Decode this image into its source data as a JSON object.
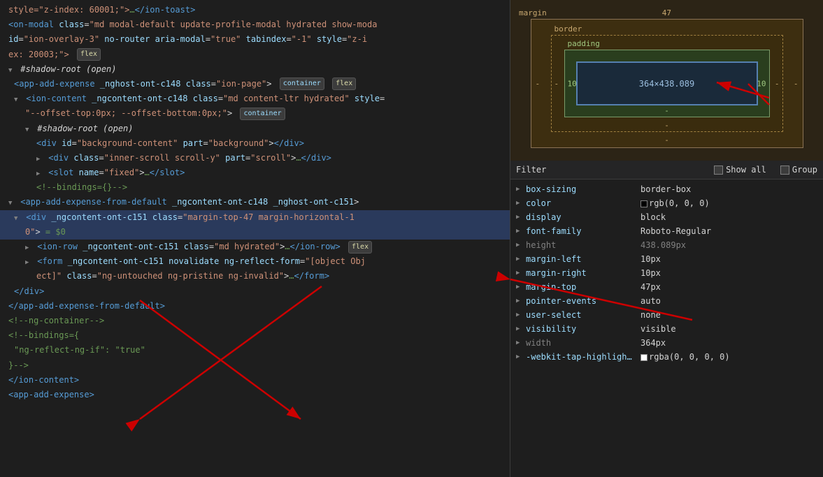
{
  "dom": {
    "lines": [
      {
        "id": 1,
        "indent": 0,
        "html": "<span class='text-orange'>style=\"z-index: 60001;\"></span><span class='comment'>…</span><span class='tag'>&lt;/ion-toast&gt;</span>",
        "highlighted": false
      },
      {
        "id": 2,
        "indent": 0,
        "html": "<span class='tag'>&lt;on-modal</span> <span class='attr-name'>class</span>=<span class='attr-value'>\"md modal-default update-profile-modal hydrated show-moda</span>",
        "highlighted": false
      },
      {
        "id": 3,
        "indent": 0,
        "html": "<span class='attr-name'>id</span>=<span class='attr-value'>\"ion-overlay-3\"</span> <span class='attr-name'>no-router</span> <span class='attr-name'>aria-modal</span>=<span class='attr-value'>\"true\"</span> <span class='attr-name'>tabindex</span>=<span class='attr-value'>\"-1\"</span> <span class='attr-name'>style</span>=<span class='attr-value'>\"z-i</span>",
        "highlighted": false
      },
      {
        "id": 4,
        "indent": 0,
        "html": "<span class='text-orange'>ex: 20003;\"></span> <span class='badge flex'>flex</span>",
        "highlighted": false
      },
      {
        "id": 5,
        "indent": 0,
        "html": "<span class='arrow open'></span> <span class='shadow'>#shadow-root (open)</span>",
        "highlighted": false
      },
      {
        "id": 6,
        "indent": 1,
        "html": "<span class='tag'>&lt;app-add-expense</span> <span class='attr-name'>_nghost-ont-c148</span> <span class='attr-name'>class</span>=<span class='attr-value'>\"ion-page\"</span>&gt; <span class='badge'>container</span> <span class='badge flex'>flex</span>",
        "highlighted": false
      },
      {
        "id": 7,
        "indent": 1,
        "html": "<span class='arrow open'></span> <span class='tag'>&lt;ion-content</span> <span class='attr-name'>_ngcontent-ont-c148</span> <span class='attr-name'>class</span>=<span class='attr-value'>\"md content-ltr hydrated\"</span> <span class='attr-name'>style</span>=",
        "highlighted": false
      },
      {
        "id": 8,
        "indent": 2,
        "html": "<span class='attr-value'>\"--offset-top:0px; --offset-bottom:0px;\"</span>&gt; <span class='badge'>container</span>",
        "highlighted": false
      },
      {
        "id": 9,
        "indent": 2,
        "html": "<span class='arrow open'></span> <span class='shadow'>#shadow-root (open)</span>",
        "highlighted": false
      },
      {
        "id": 10,
        "indent": 3,
        "html": "<span class='tag'>&lt;div</span> <span class='attr-name'>id</span>=<span class='attr-value'>\"background-content\"</span> <span class='attr-name'>part</span>=<span class='attr-value'>\"background\"</span>&gt;<span class='tag'>&lt;/div&gt;</span>",
        "highlighted": false
      },
      {
        "id": 11,
        "indent": 3,
        "html": "<span class='arrow closed'></span> <span class='tag'>&lt;div</span> <span class='attr-name'>class</span>=<span class='attr-value'>\"inner-scroll scroll-y\"</span> <span class='attr-name'>part</span>=<span class='attr-value'>\"scroll\"</span>&gt;<span class='comment'>…</span><span class='tag'>&lt;/div&gt;</span>",
        "highlighted": false
      },
      {
        "id": 12,
        "indent": 3,
        "html": "<span class='arrow closed'></span> <span class='tag'>&lt;slot</span> <span class='attr-name'>name</span>=<span class='attr-value'>\"fixed\"</span>&gt;<span class='comment'>…</span><span class='tag'>&lt;/slot&gt;</span>",
        "highlighted": false
      },
      {
        "id": 13,
        "indent": 3,
        "html": "<span class='comment'>&lt;!--bindings={}--&gt;</span>",
        "highlighted": false
      },
      {
        "id": 14,
        "indent": 0,
        "html": "<span class='arrow open'></span> <span class='tag'>&lt;app-add-expense-from-default</span> <span class='attr-name'>_ngcontent-ont-c148</span> <span class='attr-name'>_nghost-ont-c151</span>&gt;",
        "highlighted": false
      },
      {
        "id": 15,
        "indent": 1,
        "html": "<span class='arrow open'></span> <span class='tag'>&lt;div</span> <span class='attr-name'>_ngcontent-ont-c151</span> <span class='attr-name'>class</span>=<span class='attr-value'>\"margin-top-47 margin-horizontal-1</span>",
        "highlighted": true
      },
      {
        "id": 16,
        "indent": 2,
        "html": "<span class='attr-value'>0\"</span>&gt; <span class='comment'>= $0</span>",
        "highlighted": true
      },
      {
        "id": 17,
        "indent": 2,
        "html": "<span class='arrow closed'></span> <span class='tag'>&lt;ion-row</span> <span class='attr-name'>_ngcontent-ont-c151</span> <span class='attr-name'>class</span>=<span class='attr-value'>\"md hydrated\"</span>&gt;<span class='comment'>…</span><span class='tag'>&lt;/ion-row&gt;</span> <span class='badge flex'>flex</span>",
        "highlighted": false
      },
      {
        "id": 18,
        "indent": 2,
        "html": "<span class='arrow closed'></span> <span class='tag'>&lt;form</span> <span class='attr-name'>_ngcontent-ont-c151</span> <span class='attr-name'>novalidate</span> <span class='attr-name'>ng-reflect-form</span>=<span class='attr-value'>\"[object Obj</span>",
        "highlighted": false
      },
      {
        "id": 19,
        "indent": 3,
        "html": "<span class='attr-value'>ect]\"</span> <span class='attr-name'>class</span>=<span class='attr-value'>\"ng-untouched ng-pristine ng-invalid\"</span>&gt;<span class='comment'>…</span><span class='tag'>&lt;/form&gt;</span>",
        "highlighted": false
      },
      {
        "id": 20,
        "indent": 1,
        "html": "<span class='tag'>&lt;/div&gt;</span>",
        "highlighted": false
      },
      {
        "id": 21,
        "indent": 0,
        "html": "<span class='tag'>&lt;/app-add-expense-from-default&gt;</span>",
        "highlighted": false
      },
      {
        "id": 22,
        "indent": 0,
        "html": "<span class='comment'>&lt;!--ng-container--&gt;</span>",
        "highlighted": false
      },
      {
        "id": 23,
        "indent": 0,
        "html": "<span class='comment'>&lt;!--bindings={</span>",
        "highlighted": false
      },
      {
        "id": 24,
        "indent": 1,
        "html": "<span class='comment'>\"ng-reflect-ng-if\": \"true\"</span>",
        "highlighted": false
      },
      {
        "id": 25,
        "indent": 0,
        "html": "<span class='comment'>}--&gt;</span>",
        "highlighted": false
      },
      {
        "id": 26,
        "indent": 0,
        "html": "<span class='tag'>&lt;/ion-content&gt;</span>",
        "highlighted": false
      },
      {
        "id": 27,
        "indent": 0,
        "html": "<span class='tag'>&lt;app-add-expense&gt;</span>",
        "highlighted": false
      }
    ]
  },
  "box_model": {
    "margin_label": "margin",
    "margin_top": "47",
    "margin_left": "-",
    "margin_right": "-",
    "margin_bottom": "-",
    "border_label": "border",
    "border_dash": "-",
    "padding_label": "padding",
    "padding_dash": "-",
    "content_size": "364×438.089",
    "left_val": "10",
    "right_val": "10"
  },
  "css_filter": {
    "filter_label": "Filter",
    "show_all_label": "Show all",
    "group_label": "Group"
  },
  "css_properties": [
    {
      "name": "box-sizing",
      "value": "border-box",
      "toggle": true,
      "greyed": false
    },
    {
      "name": "color",
      "value": "rgb(0, 0, 0)",
      "toggle": true,
      "greyed": false,
      "swatch": "#000000"
    },
    {
      "name": "display",
      "value": "block",
      "toggle": true,
      "greyed": false
    },
    {
      "name": "font-family",
      "value": "Roboto-Regular",
      "toggle": true,
      "greyed": false
    },
    {
      "name": "height",
      "value": "438.089px",
      "toggle": true,
      "greyed": true,
      "highlighted": true
    },
    {
      "name": "margin-left",
      "value": "10px",
      "toggle": true,
      "greyed": false
    },
    {
      "name": "margin-right",
      "value": "10px",
      "toggle": true,
      "greyed": false
    },
    {
      "name": "margin-top",
      "value": "47px",
      "toggle": true,
      "greyed": false
    },
    {
      "name": "pointer-events",
      "value": "auto",
      "toggle": true,
      "greyed": false
    },
    {
      "name": "user-select",
      "value": "none",
      "toggle": true,
      "greyed": false
    },
    {
      "name": "visibility",
      "value": "visible",
      "toggle": true,
      "greyed": false
    },
    {
      "name": "width",
      "value": "364px",
      "toggle": true,
      "greyed": true
    },
    {
      "name": "-webkit-tap-highligh…",
      "value": "rgba(0, 0, 0, 0)",
      "toggle": true,
      "greyed": false,
      "swatch": "transparent"
    }
  ]
}
